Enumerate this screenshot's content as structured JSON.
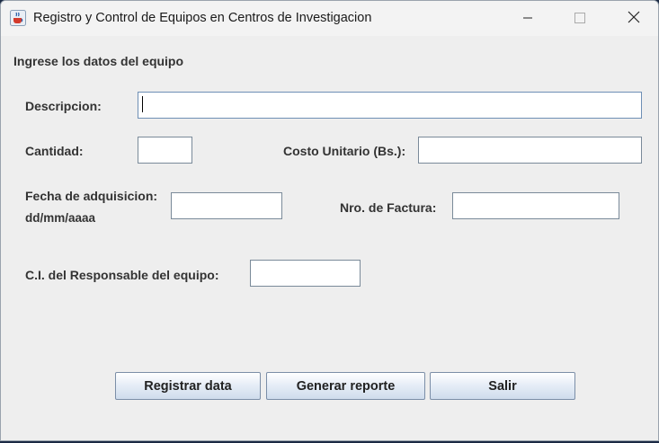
{
  "window": {
    "title": "Registro y Control de Equipos en Centros de Investigacion",
    "icon": "java-cup-icon"
  },
  "form": {
    "section_title": "Ingrese los datos del equipo",
    "descripcion_label": "Descripcion:",
    "descripcion_value": "",
    "cantidad_label": "Cantidad:",
    "cantidad_value": "",
    "costo_label": "Costo Unitario (Bs.):",
    "costo_value": "",
    "fecha_label": "Fecha de adquisicion:",
    "fecha_format": "dd/mm/aaaa",
    "fecha_value": "",
    "factura_label": "Nro. de Factura:",
    "factura_value": "",
    "responsable_label": "C.I. del Responsable del equipo:",
    "responsable_value": ""
  },
  "buttons": {
    "registrar": "Registrar data",
    "reporte": "Generar reporte",
    "salir": "Salir"
  }
}
